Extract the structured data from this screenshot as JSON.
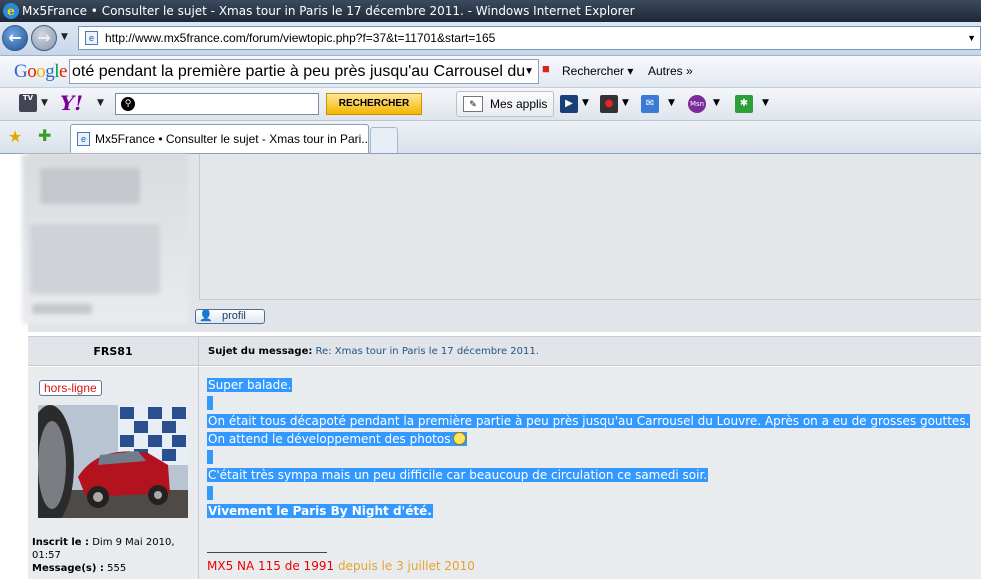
{
  "window": {
    "title": "Mx5France • Consulter le sujet - Xmas tour in Paris le 17 décembre 2011. - Windows Internet Explorer"
  },
  "address": {
    "url": "http://www.mx5france.com/forum/viewtopic.php?f=37&t=11701&start=165"
  },
  "google": {
    "logo": "Google",
    "query": "oté pendant la première partie à peu près jusqu'au Carrousel du",
    "search_label": "Rechercher",
    "more_label": "Autres"
  },
  "yahoo": {
    "search_button": "RECHERCHER",
    "apps_label": "Mes applis"
  },
  "tab": {
    "title": "Mx5France • Consulter le sujet - Xmas tour in Pari..."
  },
  "post1": {
    "profile_label": "profil"
  },
  "post2": {
    "author": "FRS81",
    "subject_label": "Sujet du message:",
    "subject": "Re: Xmas tour in Paris le 17 décembre 2011.",
    "status": "hors-ligne",
    "registered_label": "Inscrit le :",
    "registered": "Dim 9 Mai 2010, 01:57",
    "messages_label": "Message(s) :",
    "messages": "555",
    "lines": [
      "Super balade.",
      "On était tous décapoté pendant la première partie à peu près jusqu'au Carrousel du Louvre. Après on a eu de grosses gouttes.",
      "On attend le développement des photos",
      "C'était très sympa mais un peu difficile car beaucoup de circulation ce samedi soir.",
      "Vivement le Paris By Night d'été."
    ],
    "signature_car": "MX5 NA 115 de 1991",
    "signature_since": "depuis le 3 juillet 2010"
  },
  "colors": {
    "highlight": "#3399ff",
    "status_red": "#dd1111",
    "signature_orange": "#e8a12a"
  }
}
